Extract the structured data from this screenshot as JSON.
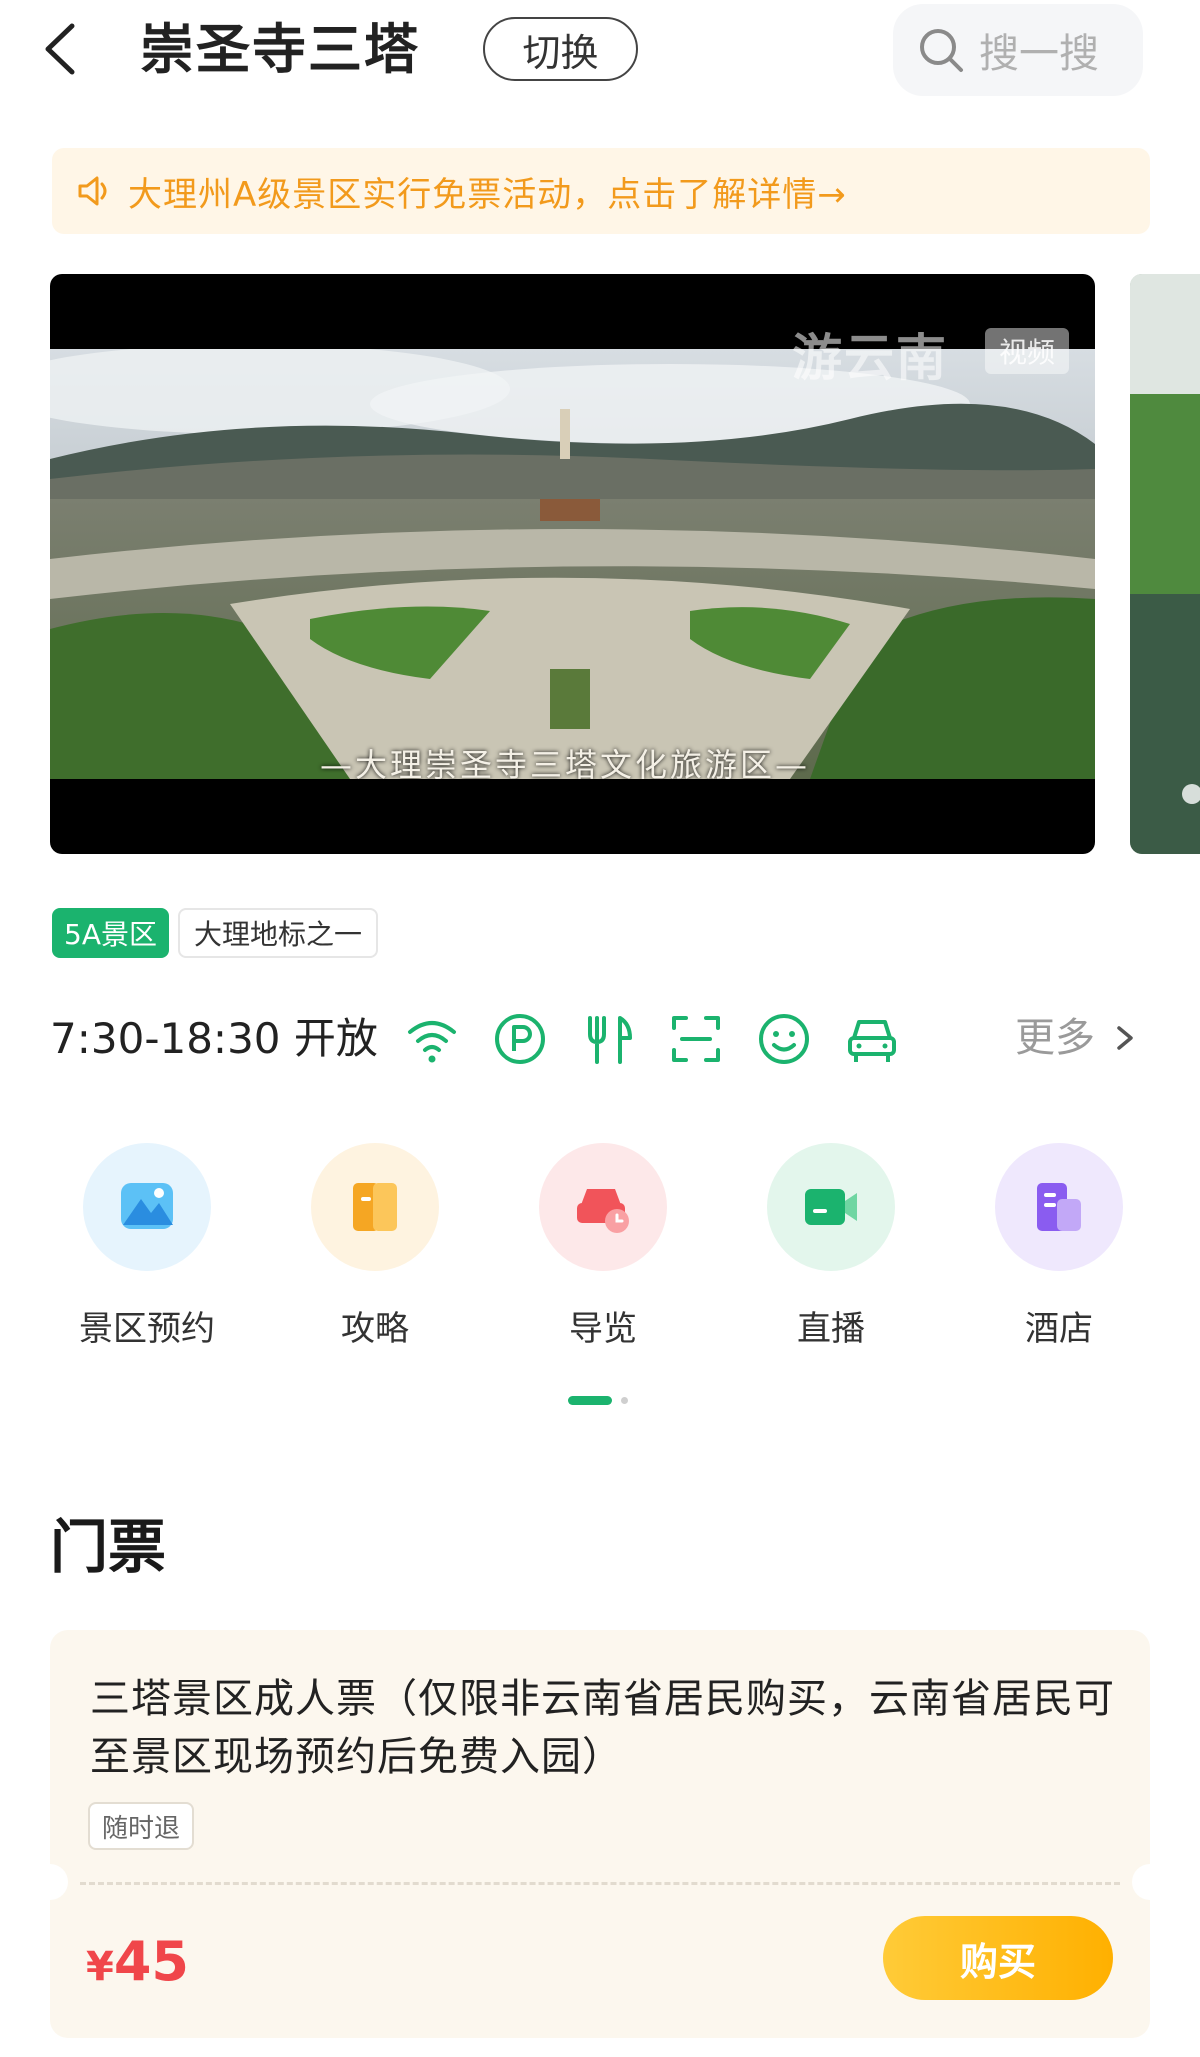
{
  "header": {
    "title": "崇圣寺三塔",
    "switch_label": "切换",
    "search_placeholder": "搜一搜",
    "icons": {
      "back": "chevron-left-icon",
      "search": "search-icon"
    }
  },
  "notice": {
    "text": "大理州A级景区实行免票活动，点击了解详情→",
    "icon": "speaker-icon",
    "color": "#f29a1c",
    "background": "#fff6e7"
  },
  "media": {
    "watermark": "游云南",
    "badge": "视频",
    "subtitle": "—大理崇圣寺三塔文化旅游区—"
  },
  "tags": [
    "5A景区",
    "大理地标之一"
  ],
  "hours": {
    "text": "7:30-18:30 开放",
    "facility_icons": [
      "wifi-icon",
      "parking-icon",
      "dining-icon",
      "scan-icon",
      "smile-icon",
      "car-icon"
    ],
    "more_label": "更多"
  },
  "quick_entries": [
    {
      "label": "景区预约",
      "icon": "mountain-icon",
      "color": "#2aa6f0",
      "bg": "#e6f4fd"
    },
    {
      "label": "攻略",
      "icon": "book-icon",
      "color": "#f5a623",
      "bg": "#fef3e0"
    },
    {
      "label": "导览",
      "icon": "car-clock-icon",
      "color": "#f1545a",
      "bg": "#fde8e9"
    },
    {
      "label": "直播",
      "icon": "video-camera-icon",
      "color": "#1bb36e",
      "bg": "#e3f6ec"
    },
    {
      "label": "酒店",
      "icon": "building-icon",
      "color": "#8a5cf0",
      "bg": "#efe8fd"
    }
  ],
  "pager": {
    "pages": 2,
    "active": 1
  },
  "tickets": {
    "section_title": "门票",
    "items": [
      {
        "name": "三塔景区成人票（仅限非云南省居民购买，云南省居民可至景区现场预约后免费入园）",
        "tag": "随时退",
        "currency": "¥",
        "price": "45",
        "buy_label": "购买"
      }
    ]
  },
  "colors": {
    "accent_green": "#1bb36e",
    "price_red": "#f0464a",
    "buy_orange": "#ffb000"
  }
}
